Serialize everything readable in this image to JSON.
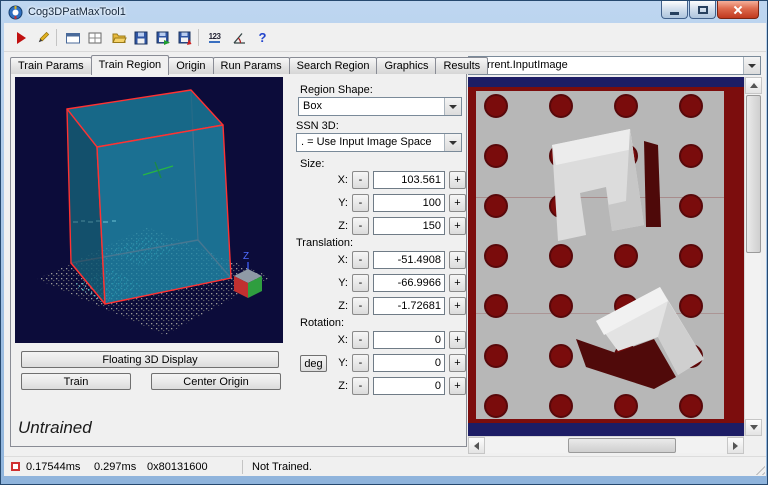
{
  "window": {
    "title": "Cog3DPatMaxTool1"
  },
  "toolbar": {
    "numbers_label": "123",
    "help_label": "?"
  },
  "tabs": {
    "selected": "Train Region",
    "items": [
      {
        "label": "Train Params"
      },
      {
        "label": "Train Region"
      },
      {
        "label": "Origin"
      },
      {
        "label": "Run Params"
      },
      {
        "label": "Search Region"
      },
      {
        "label": "Graphics"
      },
      {
        "label": "Results"
      }
    ]
  },
  "controls": {
    "region_shape": {
      "label": "Region Shape:",
      "value": "Box"
    },
    "ssn3d": {
      "label": "SSN 3D:",
      "value": ". = Use Input Image Space"
    },
    "spin_minus": "-",
    "spin_plus": "+",
    "size": {
      "label": "Size:",
      "x": {
        "axis": "X:",
        "value": "103.561"
      },
      "y": {
        "axis": "Y:",
        "value": "100"
      },
      "z": {
        "axis": "Z:",
        "value": "150"
      }
    },
    "translation": {
      "label": "Translation:",
      "x": {
        "axis": "X:",
        "value": "-51.4908"
      },
      "y": {
        "axis": "Y:",
        "value": "-66.9966"
      },
      "z": {
        "axis": "Z:",
        "value": "-1.72681"
      }
    },
    "rotation": {
      "label": "Rotation:",
      "deg_label": "deg",
      "x": {
        "axis": "X:",
        "value": "0"
      },
      "y": {
        "axis": "Y:",
        "value": "0"
      },
      "z": {
        "axis": "Z:",
        "value": "0"
      }
    }
  },
  "left_panel": {
    "floating_button": "Floating 3D Display",
    "train_button": "Train",
    "center_origin_button": "Center Origin",
    "train_status": "Untrained",
    "axis_z": "Z"
  },
  "right_panel": {
    "image_selector": "Current.InputImage"
  },
  "status_bar": {
    "time1": "0.17544ms",
    "time2": "0.297ms",
    "result_code": "0x80131600",
    "message": "Not Trained."
  },
  "colors": {
    "viewport_background": "#0c0c3a",
    "region_box_fill": "#1e86a6",
    "region_box_edge": "#ff3232",
    "image_background": "#7c0d0d",
    "plate_gray": "#b7b7b7",
    "status_indicator": "#d03030"
  }
}
